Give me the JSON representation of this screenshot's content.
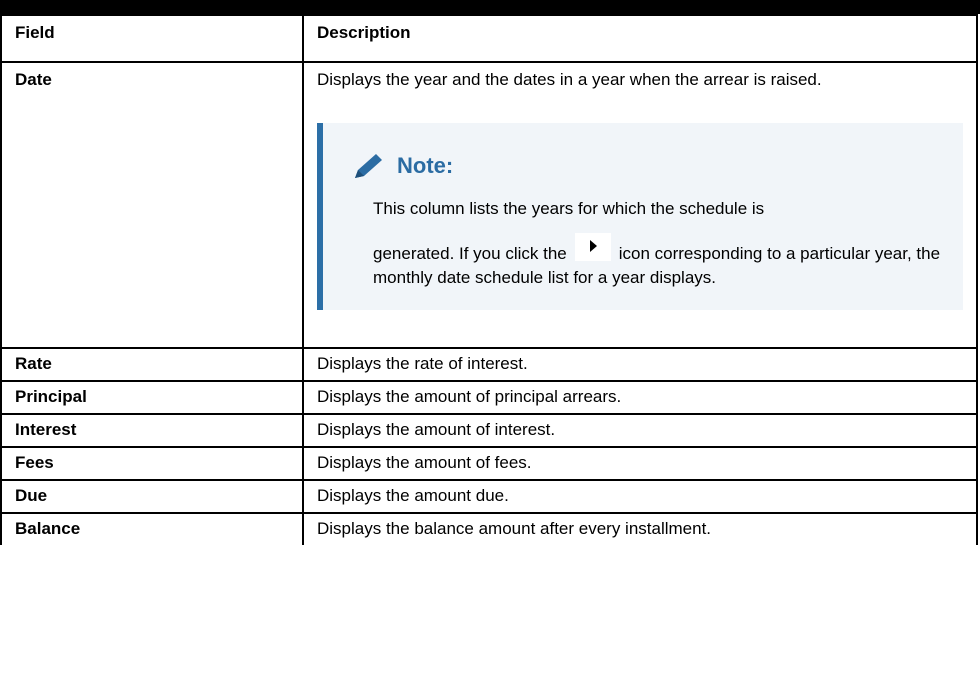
{
  "table": {
    "header": {
      "field": "Field",
      "description": "Description"
    },
    "rows": [
      {
        "field": "Date",
        "description": "Displays the year and the dates in a year when the arrear is raised."
      },
      {
        "field": "Rate",
        "description": "Displays the rate of interest."
      },
      {
        "field": "Principal",
        "description": "Displays the amount of principal arrears."
      },
      {
        "field": "Interest",
        "description": "Displays the amount of interest."
      },
      {
        "field": "Fees",
        "description": "Displays the amount of fees."
      },
      {
        "field": "Due",
        "description": "Displays the amount due."
      },
      {
        "field": "Balance",
        "description": "Displays the balance amount after every installment."
      }
    ]
  },
  "note": {
    "title": "Note:",
    "line1": "This column lists the years for which the schedule is",
    "text_before_icon": "generated. If you click the",
    "text_after_icon": "icon corresponding to a particular year, the monthly date schedule list for a year displays.",
    "icon": "play-triangle-icon",
    "accent_color": "#2c6fa7",
    "background_color": "#f1f5f9"
  }
}
